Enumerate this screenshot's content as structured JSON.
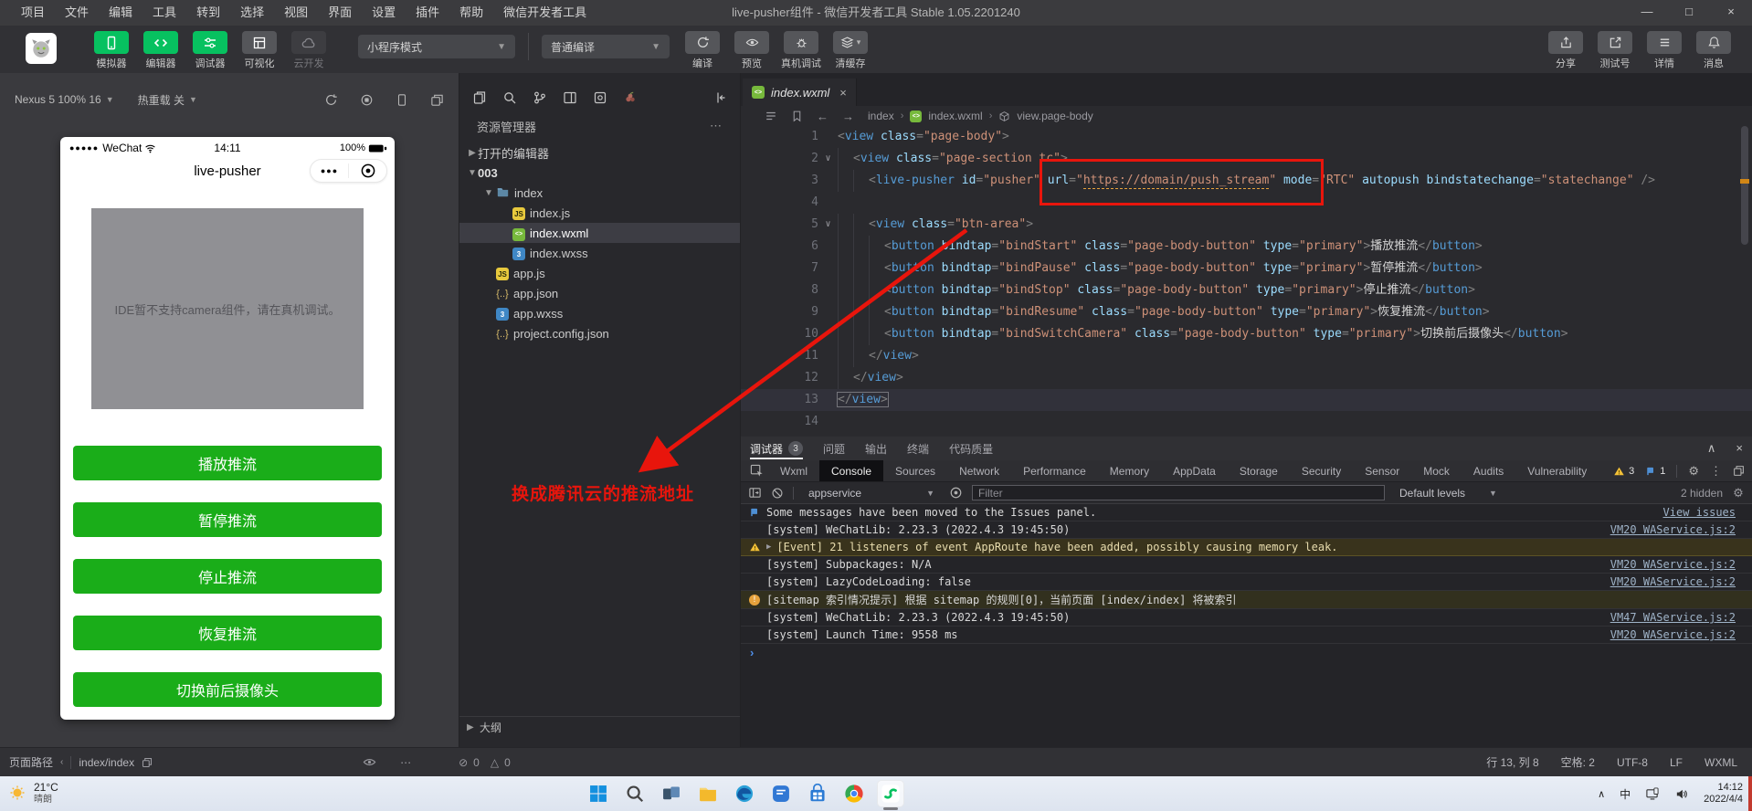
{
  "window": {
    "title": "live-pusher组件 - 微信开发者工具 Stable 1.05.2201240",
    "menus": [
      "项目",
      "文件",
      "编辑",
      "工具",
      "转到",
      "选择",
      "视图",
      "界面",
      "设置",
      "插件",
      "帮助",
      "微信开发者工具"
    ],
    "controls": {
      "minimize": "—",
      "maximize": "□",
      "close": "×"
    }
  },
  "toolbar": {
    "main_buttons": [
      {
        "label": "模拟器",
        "icon": "phone",
        "style": "green"
      },
      {
        "label": "编辑器",
        "icon": "code",
        "style": "green"
      },
      {
        "label": "调试器",
        "icon": "sliders",
        "style": "green"
      },
      {
        "label": "可视化",
        "icon": "grid",
        "style": "gray"
      },
      {
        "label": "云开发",
        "icon": "cloud",
        "style": "dim"
      }
    ],
    "mode_select": "小程序模式",
    "compile_select": "普通编译",
    "actions": [
      {
        "label": "编译",
        "icon": "refresh"
      },
      {
        "label": "预览",
        "icon": "eye"
      },
      {
        "label": "真机调试",
        "icon": "bug"
      },
      {
        "label": "清缓存",
        "icon": "layers",
        "caret": true
      }
    ],
    "right_actions": [
      {
        "label": "分享",
        "icon": "share"
      },
      {
        "label": "测试号",
        "icon": "external"
      },
      {
        "label": "详情",
        "icon": "list"
      },
      {
        "label": "消息",
        "icon": "bell"
      }
    ]
  },
  "simulator": {
    "device": "Nexus 5 100% 16",
    "hot_reload": "热重载 关",
    "phone": {
      "carrier": "WeChat",
      "time": "14:11",
      "battery": "100%",
      "nav_title": "live-pusher",
      "camera_placeholder": "IDE暂不支持camera组件，请在真机调试。",
      "buttons": [
        "播放推流",
        "暂停推流",
        "停止推流",
        "恢复推流",
        "切换前后摄像头"
      ]
    }
  },
  "explorer": {
    "title": "资源管理器",
    "activity_icons": [
      "files",
      "search",
      "source-control",
      "split-editor",
      "package",
      "plugins"
    ],
    "open_editors": "打开的编辑器",
    "project": "003",
    "outline": "大纲",
    "tree": [
      {
        "label": "index",
        "icon": "folder",
        "indent": 1,
        "arrow": "down"
      },
      {
        "label": "index.js",
        "icon": "js",
        "indent": 2
      },
      {
        "label": "index.wxml",
        "icon": "wxml",
        "indent": 2,
        "selected": true
      },
      {
        "label": "index.wxss",
        "icon": "wxss",
        "indent": 2
      },
      {
        "label": "app.js",
        "icon": "js",
        "indent": 1
      },
      {
        "label": "app.json",
        "icon": "json",
        "indent": 1
      },
      {
        "label": "app.wxss",
        "icon": "wxss",
        "indent": 1
      },
      {
        "label": "project.config.json",
        "icon": "json",
        "indent": 1
      }
    ]
  },
  "editor": {
    "tab": "index.wxml",
    "breadcrumb": [
      "index",
      "index.wxml",
      "view.page-body"
    ],
    "annotation": "换成腾讯云的推流地址",
    "lines": [
      {
        "n": 1,
        "ind": 0,
        "seg": [
          [
            "p",
            "<"
          ],
          [
            "t",
            "view"
          ],
          [
            "w",
            " "
          ],
          [
            "a",
            "class"
          ],
          [
            "p",
            "="
          ],
          [
            "s",
            "\"page-body\""
          ],
          [
            "p",
            ">"
          ]
        ]
      },
      {
        "n": 2,
        "ind": 1,
        "fold": true,
        "seg": [
          [
            "p",
            "<"
          ],
          [
            "t",
            "view"
          ],
          [
            "w",
            " "
          ],
          [
            "a",
            "class"
          ],
          [
            "p",
            "="
          ],
          [
            "s",
            "\"page-section tc\""
          ],
          [
            "p",
            ">"
          ]
        ]
      },
      {
        "n": 3,
        "ind": 2,
        "box": [
          7,
          14
        ],
        "seg": [
          [
            "p",
            "<"
          ],
          [
            "t",
            "live-pusher"
          ],
          [
            "w",
            " "
          ],
          [
            "a",
            "id"
          ],
          [
            "p",
            "="
          ],
          [
            "s",
            "\"pusher\""
          ],
          [
            "w",
            " "
          ],
          [
            "a",
            "url"
          ],
          [
            "p",
            "="
          ],
          [
            "s",
            "\""
          ],
          [
            "u",
            "https://domain/push_stream"
          ],
          [
            "s",
            "\""
          ],
          [
            "w",
            " "
          ],
          [
            "a",
            "mode"
          ],
          [
            "p",
            "="
          ],
          [
            "s",
            "\"RTC\""
          ],
          [
            "w",
            " "
          ],
          [
            "a",
            "autopush"
          ],
          [
            "w",
            " "
          ],
          [
            "a",
            "bindstatechange"
          ],
          [
            "p",
            "="
          ],
          [
            "s",
            "\"statechange\""
          ],
          [
            "w",
            " "
          ],
          [
            "p",
            "/>"
          ]
        ]
      },
      {
        "n": 4,
        "ind": 0,
        "seg": []
      },
      {
        "n": 5,
        "ind": 2,
        "fold": true,
        "seg": [
          [
            "p",
            "<"
          ],
          [
            "t",
            "view"
          ],
          [
            "w",
            " "
          ],
          [
            "a",
            "class"
          ],
          [
            "p",
            "="
          ],
          [
            "s",
            "\"btn-area\""
          ],
          [
            "p",
            ">"
          ]
        ]
      },
      {
        "n": 6,
        "ind": 3,
        "seg": [
          [
            "p",
            "<"
          ],
          [
            "t",
            "button"
          ],
          [
            "w",
            " "
          ],
          [
            "a",
            "bindtap"
          ],
          [
            "p",
            "="
          ],
          [
            "s",
            "\"bindStart\""
          ],
          [
            "w",
            " "
          ],
          [
            "a",
            "class"
          ],
          [
            "p",
            "="
          ],
          [
            "s",
            "\"page-body-button\""
          ],
          [
            "w",
            " "
          ],
          [
            "a",
            "type"
          ],
          [
            "p",
            "="
          ],
          [
            "s",
            "\"primary\""
          ],
          [
            "p",
            ">"
          ],
          [
            "w",
            "播放推流"
          ],
          [
            "p",
            "</"
          ],
          [
            "t",
            "button"
          ],
          [
            "p",
            ">"
          ]
        ]
      },
      {
        "n": 7,
        "ind": 3,
        "seg": [
          [
            "p",
            "<"
          ],
          [
            "t",
            "button"
          ],
          [
            "w",
            " "
          ],
          [
            "a",
            "bindtap"
          ],
          [
            "p",
            "="
          ],
          [
            "s",
            "\"bindPause\""
          ],
          [
            "w",
            " "
          ],
          [
            "a",
            "class"
          ],
          [
            "p",
            "="
          ],
          [
            "s",
            "\"page-body-button\""
          ],
          [
            "w",
            " "
          ],
          [
            "a",
            "type"
          ],
          [
            "p",
            "="
          ],
          [
            "s",
            "\"primary\""
          ],
          [
            "p",
            ">"
          ],
          [
            "w",
            "暂停推流"
          ],
          [
            "p",
            "</"
          ],
          [
            "t",
            "button"
          ],
          [
            "p",
            ">"
          ]
        ]
      },
      {
        "n": 8,
        "ind": 3,
        "seg": [
          [
            "p",
            "<"
          ],
          [
            "t",
            "button"
          ],
          [
            "w",
            " "
          ],
          [
            "a",
            "bindtap"
          ],
          [
            "p",
            "="
          ],
          [
            "s",
            "\"bindStop\""
          ],
          [
            "w",
            " "
          ],
          [
            "a",
            "class"
          ],
          [
            "p",
            "="
          ],
          [
            "s",
            "\"page-body-button\""
          ],
          [
            "w",
            " "
          ],
          [
            "a",
            "type"
          ],
          [
            "p",
            "="
          ],
          [
            "s",
            "\"primary\""
          ],
          [
            "p",
            ">"
          ],
          [
            "w",
            "停止推流"
          ],
          [
            "p",
            "</"
          ],
          [
            "t",
            "button"
          ],
          [
            "p",
            ">"
          ]
        ]
      },
      {
        "n": 9,
        "ind": 3,
        "seg": [
          [
            "p",
            "<"
          ],
          [
            "t",
            "button"
          ],
          [
            "w",
            " "
          ],
          [
            "a",
            "bindtap"
          ],
          [
            "p",
            "="
          ],
          [
            "s",
            "\"bindResume\""
          ],
          [
            "w",
            " "
          ],
          [
            "a",
            "class"
          ],
          [
            "p",
            "="
          ],
          [
            "s",
            "\"page-body-button\""
          ],
          [
            "w",
            " "
          ],
          [
            "a",
            "type"
          ],
          [
            "p",
            "="
          ],
          [
            "s",
            "\"primary\""
          ],
          [
            "p",
            ">"
          ],
          [
            "w",
            "恢复推流"
          ],
          [
            "p",
            "</"
          ],
          [
            "t",
            "button"
          ],
          [
            "p",
            ">"
          ]
        ]
      },
      {
        "n": 10,
        "ind": 3,
        "seg": [
          [
            "p",
            "<"
          ],
          [
            "t",
            "button"
          ],
          [
            "w",
            " "
          ],
          [
            "a",
            "bindtap"
          ],
          [
            "p",
            "="
          ],
          [
            "s",
            "\"bindSwitchCamera\""
          ],
          [
            "w",
            " "
          ],
          [
            "a",
            "class"
          ],
          [
            "p",
            "="
          ],
          [
            "s",
            "\"page-body-button\""
          ],
          [
            "w",
            " "
          ],
          [
            "a",
            "type"
          ],
          [
            "p",
            "="
          ],
          [
            "s",
            "\"primary\""
          ],
          [
            "p",
            ">"
          ],
          [
            "w",
            "切换前后摄像头"
          ],
          [
            "p",
            "</"
          ],
          [
            "t",
            "button"
          ],
          [
            "p",
            ">"
          ]
        ]
      },
      {
        "n": 11,
        "ind": 2,
        "seg": [
          [
            "p",
            "</"
          ],
          [
            "t",
            "view"
          ],
          [
            "p",
            ">"
          ]
        ]
      },
      {
        "n": 12,
        "ind": 1,
        "seg": [
          [
            "p",
            "</"
          ],
          [
            "t",
            "view"
          ],
          [
            "p",
            ">"
          ]
        ]
      },
      {
        "n": 13,
        "ind": 0,
        "cursor": true,
        "seg": [
          [
            "p",
            "</"
          ],
          [
            "t",
            "view"
          ],
          [
            "p",
            ">"
          ]
        ]
      },
      {
        "n": 14,
        "ind": 0,
        "seg": []
      }
    ]
  },
  "debugger": {
    "tabs": [
      {
        "label": "调试器",
        "badge": "3",
        "active": true
      },
      {
        "label": "问题"
      },
      {
        "label": "输出"
      },
      {
        "label": "终端"
      },
      {
        "label": "代码质量"
      }
    ],
    "collapse": "∧",
    "close": "×",
    "devtools_tabs": [
      "Wxml",
      "Console",
      "Sources",
      "Network",
      "Performance",
      "Memory",
      "AppData",
      "Storage",
      "Security",
      "Sensor",
      "Mock",
      "Audits",
      "Vulnerability"
    ],
    "active_devtools_tab": "Console",
    "warn_count": "3",
    "issue_count": "1",
    "console_toolbar": {
      "context": "appservice",
      "filter_placeholder": "Filter",
      "levels": "Default levels",
      "hidden": "2 hidden"
    },
    "messages": [
      {
        "icon": "issue",
        "text": "Some messages have been moved to the Issues panel.",
        "link": "View issues"
      },
      {
        "text": "[system] WeChatLib: 2.23.3 (2022.4.3 19:45:50)",
        "link": "VM20 WAService.js:2"
      },
      {
        "icon": "warn",
        "expand": true,
        "style": "warning",
        "text": "[Event] 21 listeners of event AppRoute have been added, possibly causing memory leak."
      },
      {
        "text": "[system] Subpackages: N/A",
        "link": "VM20 WAService.js:2"
      },
      {
        "text": "[system] LazyCodeLoading: false",
        "link": "VM20 WAService.js:2"
      },
      {
        "icon": "sitemap",
        "style": "notice",
        "text": "[sitemap 索引情况提示] 根据 sitemap 的规则[0]，当前页面 [index/index] 将被索引"
      },
      {
        "text": "[system] WeChatLib: 2.23.3 (2022.4.3 19:45:50)",
        "link": "VM47 WAService.js:2"
      },
      {
        "text": "[system] Launch Time: 9558 ms",
        "link": "VM20 WAService.js:2"
      }
    ],
    "prompt": "›"
  },
  "statusbar": {
    "page_path_label": "页面路径",
    "page_path": "index/index",
    "error_count": "0",
    "warning_count": "0",
    "right_items": [
      "行 13, 列 8",
      "空格: 2",
      "UTF-8",
      "LF",
      "WXML"
    ]
  },
  "taskbar": {
    "weather_temp": "21°C",
    "weather_desc": "晴朗",
    "apps": [
      "start",
      "search",
      "task-view",
      "file-explorer",
      "edge",
      "chat",
      "store",
      "chrome",
      "wechat-devtools"
    ],
    "active_app": "wechat-devtools",
    "ime": "中",
    "time": "14:12",
    "date": "2022/4/4"
  }
}
